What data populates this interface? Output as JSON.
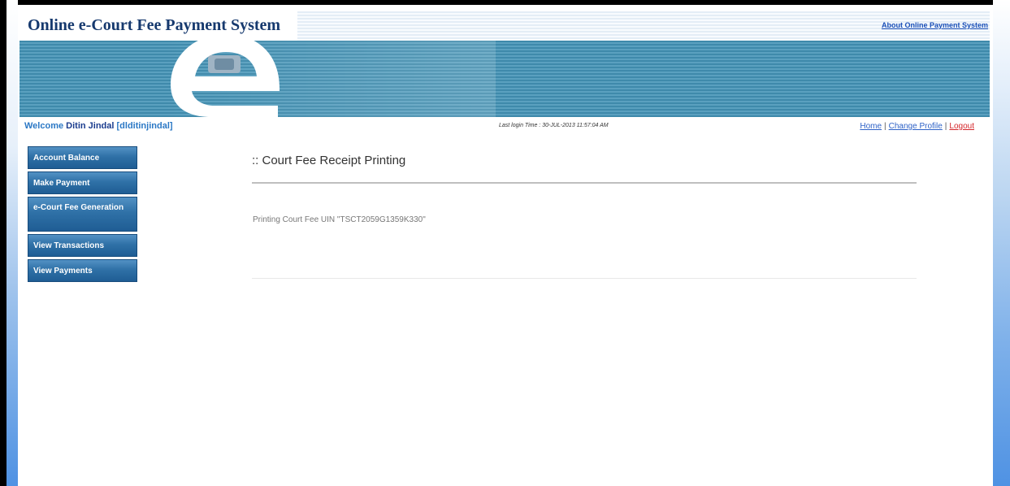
{
  "header": {
    "site_title": "Online e-Court Fee Payment System",
    "about_link": "About Online Payment System"
  },
  "user_bar": {
    "welcome_label": "Welcome",
    "user_name": "Ditin Jindal",
    "user_id": "[dlditinjindal]",
    "last_login": "Last login Time : 30-JUL-2013 11:57:04 AM",
    "links": {
      "home": "Home",
      "change_profile": "Change Profile",
      "logout": "Logout",
      "separator": "|"
    }
  },
  "sidebar": {
    "items": [
      {
        "label": "Account Balance"
      },
      {
        "label": "Make Payment"
      },
      {
        "label": "e-Court Fee Generation"
      },
      {
        "label": "View Transactions"
      },
      {
        "label": "View Payments"
      }
    ]
  },
  "main": {
    "title": ":: Court Fee Receipt Printing",
    "message": "Printing Court Fee UIN \"TSCT2059G1359K330\""
  },
  "colors": {
    "banner": "#3f8aab",
    "nav_button": "#2f71a7",
    "title_text": "#16396e",
    "logout_link": "#d4262a"
  }
}
